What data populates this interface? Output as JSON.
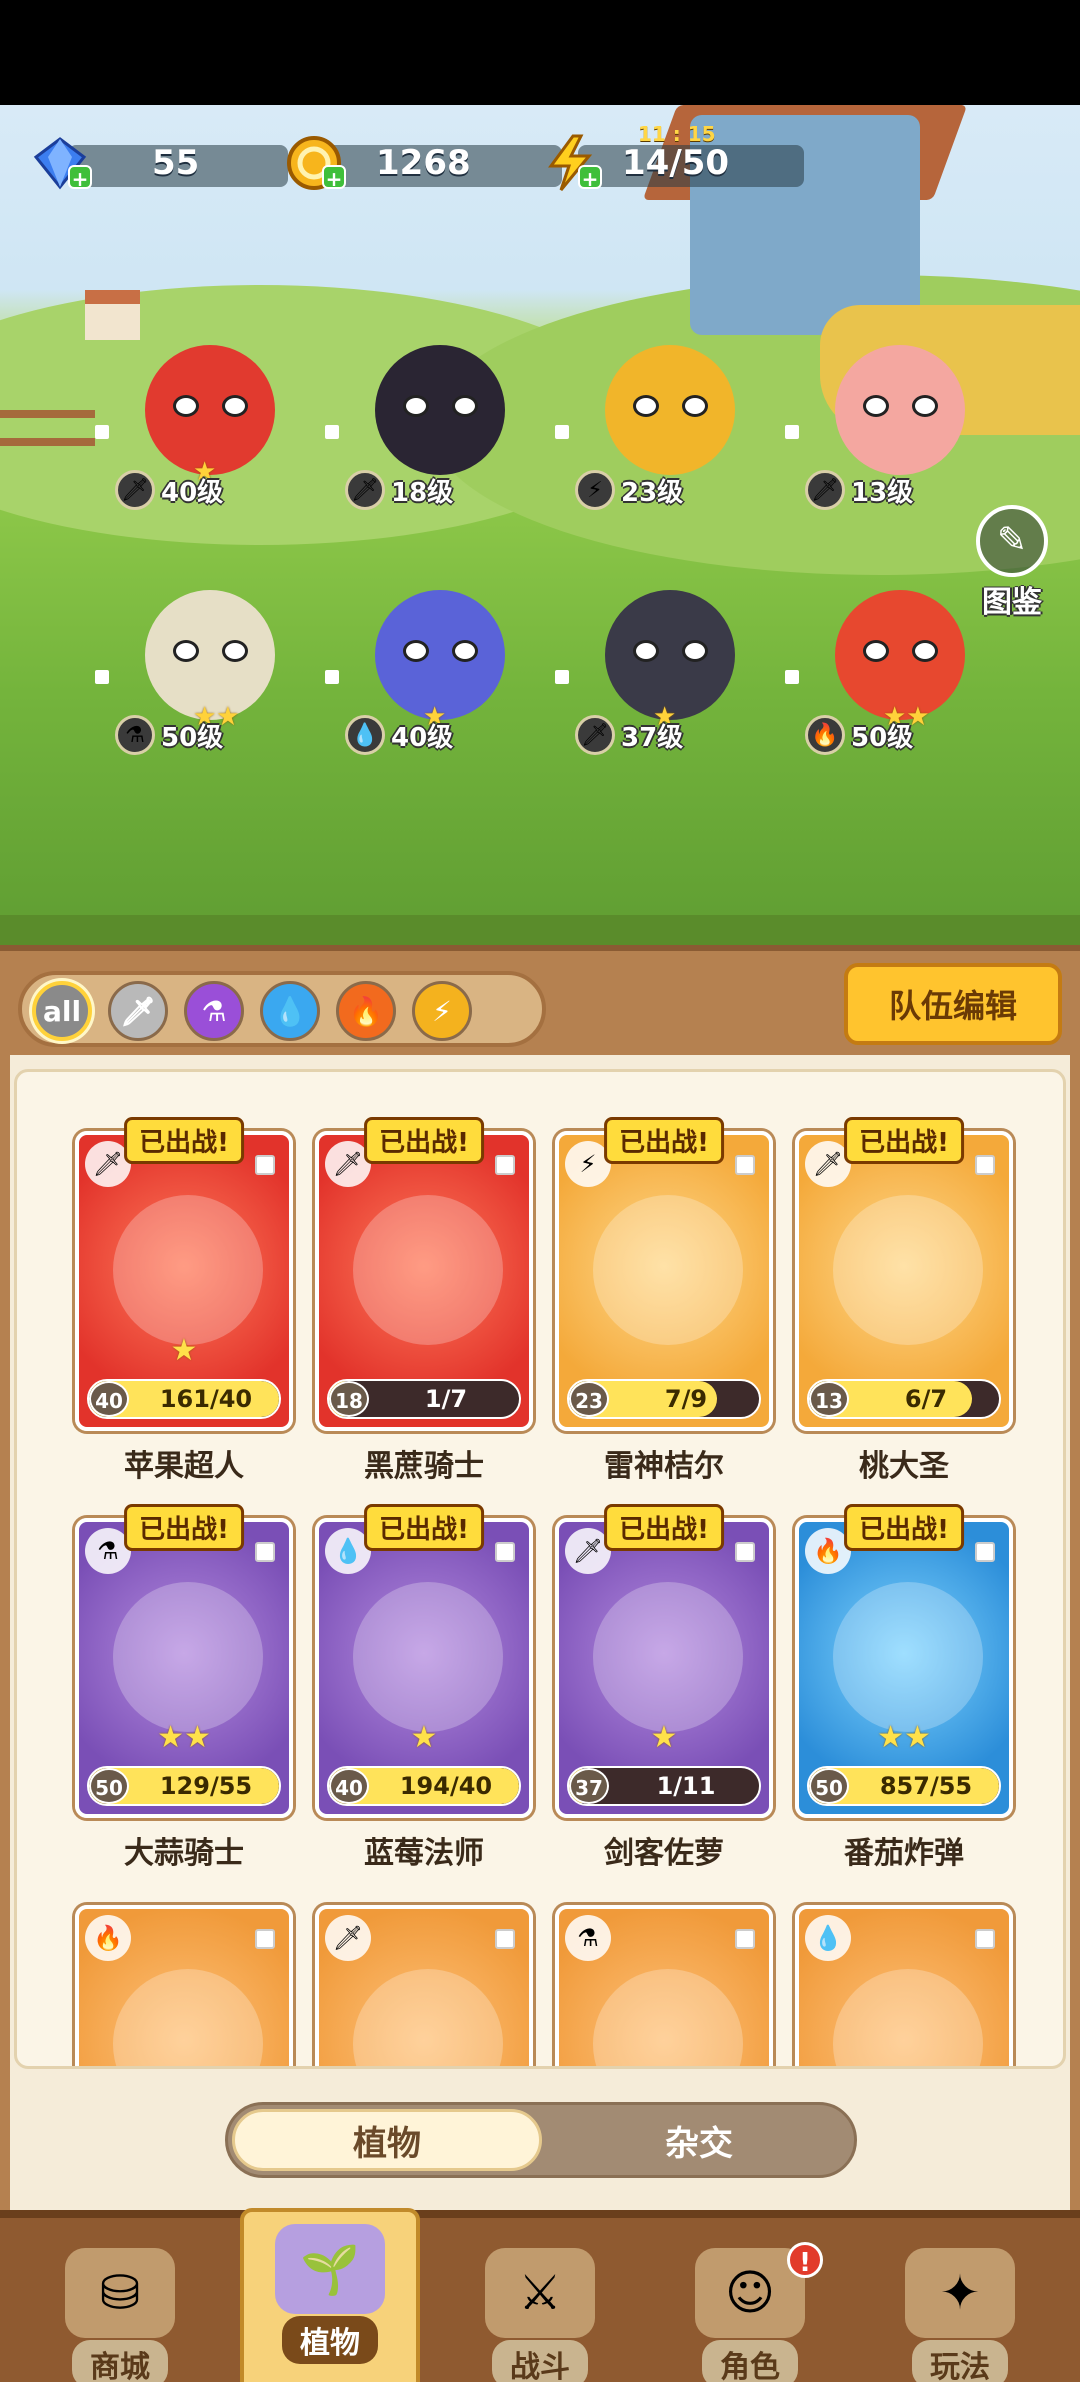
{
  "resources": {
    "gems": {
      "value": "55",
      "icon": "diamond-icon"
    },
    "coins": {
      "value": "1268",
      "icon": "coin-icon"
    },
    "energy": {
      "value": "14/50",
      "timer": "11 : 15",
      "icon": "lightning-icon"
    }
  },
  "atlas": {
    "label": "图鉴",
    "icon": "book-icon"
  },
  "team": [
    {
      "level": "40级",
      "element": "sword",
      "stars": "★",
      "color": "#e13a2f"
    },
    {
      "level": "18级",
      "element": "sword",
      "stars": "",
      "color": "#2a2533"
    },
    {
      "level": "23级",
      "element": "lightning",
      "stars": "",
      "color": "#f1b52a"
    },
    {
      "level": "13级",
      "element": "sword",
      "stars": "",
      "color": "#f4a7a0"
    },
    {
      "level": "50级",
      "element": "potion",
      "stars": "★★",
      "color": "#e6dfc6"
    },
    {
      "level": "40级",
      "element": "water",
      "stars": "★",
      "color": "#5a63d8"
    },
    {
      "level": "37级",
      "element": "sword",
      "stars": "★",
      "color": "#3a3a48"
    },
    {
      "level": "50级",
      "element": "fire",
      "stars": "★★",
      "color": "#e7482f"
    }
  ],
  "filters": {
    "all_label": "all",
    "items": [
      "all",
      "sword",
      "potion",
      "water",
      "fire",
      "lightning"
    ]
  },
  "team_edit_label": "队伍编辑",
  "deployed_label": "已出战!",
  "cards": [
    {
      "name": "苹果超人",
      "level": "40",
      "progress": "161/40",
      "fill": 1.0,
      "theme": "red",
      "element": "sword",
      "stars": "★",
      "deployed": true
    },
    {
      "name": "黑蔗骑士",
      "level": "18",
      "progress": "1/7",
      "fill": 0.14,
      "theme": "red",
      "element": "sword",
      "stars": "",
      "deployed": true
    },
    {
      "name": "雷神桔尔",
      "level": "23",
      "progress": "7/9",
      "fill": 0.78,
      "theme": "gold",
      "element": "lightning",
      "stars": "",
      "deployed": true
    },
    {
      "name": "桃大圣",
      "level": "13",
      "progress": "6/7",
      "fill": 0.86,
      "theme": "gold",
      "element": "sword",
      "stars": "",
      "deployed": true
    },
    {
      "name": "大蒜骑士",
      "level": "50",
      "progress": "129/55",
      "fill": 1.0,
      "theme": "purple",
      "element": "potion",
      "stars": "★★",
      "deployed": true
    },
    {
      "name": "蓝莓法师",
      "level": "40",
      "progress": "194/40",
      "fill": 1.0,
      "theme": "purple",
      "element": "water",
      "stars": "★",
      "deployed": true
    },
    {
      "name": "剑客佐萝",
      "level": "37",
      "progress": "1/11",
      "fill": 0.09,
      "theme": "purple",
      "element": "sword",
      "stars": "★",
      "deployed": true
    },
    {
      "name": "番茄炸弹",
      "level": "50",
      "progress": "857/55",
      "fill": 1.0,
      "theme": "blue",
      "element": "fire",
      "stars": "★★",
      "deployed": true
    },
    {
      "name": "",
      "theme": "orange",
      "element": "fire"
    },
    {
      "name": "",
      "theme": "orange",
      "element": "sword"
    },
    {
      "name": "",
      "theme": "orange",
      "element": "potion"
    },
    {
      "name": "",
      "theme": "orange",
      "element": "water"
    }
  ],
  "segment": {
    "active": "植物",
    "inactive": "杂交"
  },
  "nav": [
    {
      "label": "商城",
      "icon": "shop-icon",
      "active": false
    },
    {
      "label": "植物",
      "icon": "plants-icon",
      "active": true
    },
    {
      "label": "战斗",
      "icon": "battle-icon",
      "active": false
    },
    {
      "label": "角色",
      "icon": "character-icon",
      "active": false,
      "alert": "!"
    },
    {
      "label": "玩法",
      "icon": "gameplay-icon",
      "active": false
    }
  ]
}
